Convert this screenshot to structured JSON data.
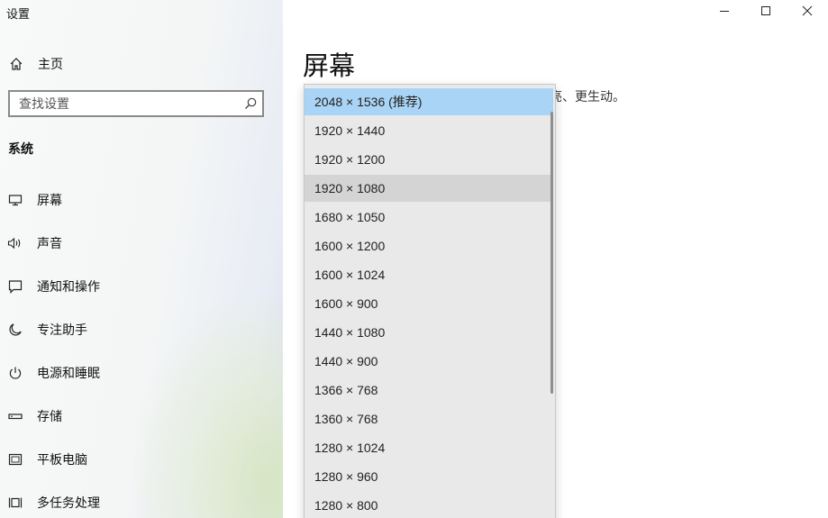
{
  "window": {
    "title": "设置",
    "controls": [
      "minimize",
      "maximize",
      "close"
    ]
  },
  "sidebar": {
    "home": {
      "label": "主页",
      "icon": "home-icon"
    },
    "search": {
      "placeholder": "查找设置",
      "value": "",
      "icon": "search-icon"
    },
    "section_title": "系统",
    "items": [
      {
        "label": "屏幕",
        "icon": "display-icon"
      },
      {
        "label": "声音",
        "icon": "speaker-icon"
      },
      {
        "label": "通知和操作",
        "icon": "notification-icon"
      },
      {
        "label": "专注助手",
        "icon": "moon-icon"
      },
      {
        "label": "电源和睡眠",
        "icon": "power-icon"
      },
      {
        "label": "存储",
        "icon": "storage-icon"
      },
      {
        "label": "平板电脑",
        "icon": "tablet-icon"
      },
      {
        "label": "多任务处理",
        "icon": "multitask-icon"
      }
    ]
  },
  "main": {
    "title": "屏幕",
    "description_fragment": "亮、更生动。"
  },
  "resolution_dropdown": {
    "selected": "2048 × 1536 (推荐)",
    "hovered": "1920 × 1080",
    "options": [
      "2048 × 1536 (推荐)",
      "1920 × 1440",
      "1920 × 1200",
      "1920 × 1080",
      "1680 × 1050",
      "1600 × 1200",
      "1600 × 1024",
      "1600 × 900",
      "1440 × 1080",
      "1440 × 900",
      "1366 × 768",
      "1360 × 768",
      "1280 × 1024",
      "1280 × 960",
      "1280 × 800"
    ]
  },
  "colors": {
    "selected_option": "#a9d4f5",
    "hover_option": "#d4d4d4",
    "dropdown_bg": "#e9e9e9"
  }
}
